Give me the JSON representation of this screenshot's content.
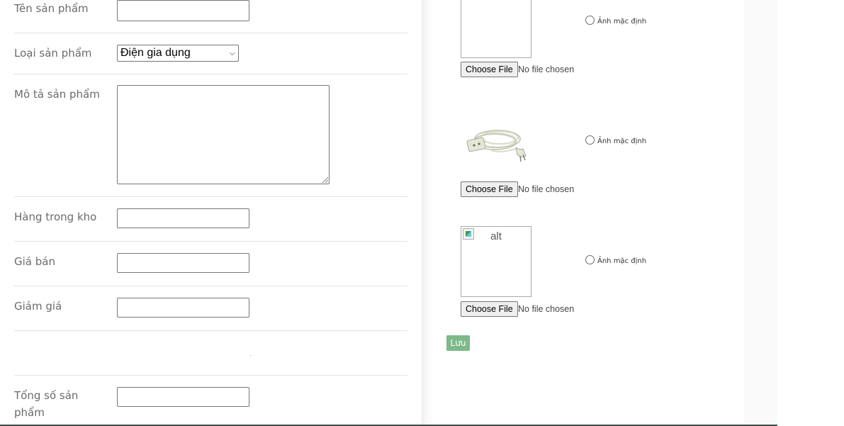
{
  "form": {
    "product_name_label": "Tên sản phẩm",
    "product_name_value": "",
    "product_type_label": "Loại sản phẩm",
    "product_type_selected": "Điện gia dụng",
    "description_label": "Mô tả sản phẩm",
    "description_value": "",
    "stock_label": "Hàng trong kho",
    "stock_value": "",
    "price_label": "Giá bán",
    "price_value": "",
    "discount_label": "Giảm giá",
    "discount_value": "",
    "total_label_line1": "Tổng số sản",
    "total_label_line2": "phẩm",
    "total_value": ""
  },
  "images": {
    "slots": [
      {
        "choose_label": "Choose File",
        "file_status": "No file chosen",
        "radio_label": "Ảnh mặc định",
        "preview": "empty"
      },
      {
        "choose_label": "Choose File",
        "file_status": "No file chosen",
        "radio_label": "Ảnh mặc định",
        "preview": "extension-cord-photo"
      },
      {
        "choose_label": "Choose File",
        "file_status": "No file chosen",
        "radio_label": "Ảnh mặc định",
        "preview": "broken-image",
        "alt_text": "alt"
      }
    ],
    "save_label": "Lưu"
  },
  "colors": {
    "save_button": "#7fb88a",
    "field_border": "#767676",
    "label_text": "#6b6b6b"
  }
}
